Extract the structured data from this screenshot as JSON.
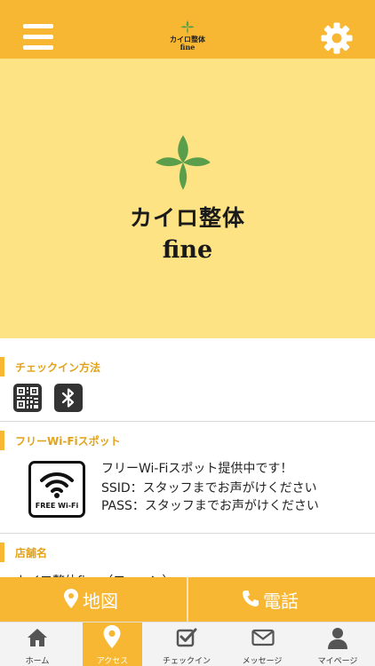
{
  "header": {
    "menu_icon": "menu-icon",
    "logo_title": "カイロ整体",
    "logo_sub": "fine",
    "settings_icon": "gear-icon"
  },
  "hero": {
    "title": "カイロ整体",
    "subtitle": "fine"
  },
  "checkin": {
    "heading": "チェックイン方法",
    "icons": [
      "qr-code-icon",
      "bluetooth-icon"
    ]
  },
  "wifi": {
    "heading": "フリーWi-Fiスポット",
    "logo_text": "FREE Wi-Fi",
    "lines": [
      "フリーWi-Fiスポット提供中です！",
      "SSID：スタッフまでお声がけください",
      "PASS：スタッフまでお声がけください"
    ]
  },
  "shop": {
    "heading": "店舗名",
    "name": "カイロ整体fine（フィーン）"
  },
  "actions": {
    "map_label": "地図",
    "phone_label": "電話"
  },
  "tabs": [
    {
      "label": "ホーム",
      "icon": "home-icon"
    },
    {
      "label": "アクセス",
      "icon": "map-pin-icon",
      "active": true
    },
    {
      "label": "チェックイン",
      "icon": "checkin-icon"
    },
    {
      "label": "メッセージ",
      "icon": "envelope-icon"
    },
    {
      "label": "マイページ",
      "icon": "user-icon"
    }
  ],
  "colors": {
    "accent": "#f7b733",
    "hero_bg": "#fde384",
    "leaf": "#5a9e4b",
    "section_text": "#e2a21a"
  }
}
